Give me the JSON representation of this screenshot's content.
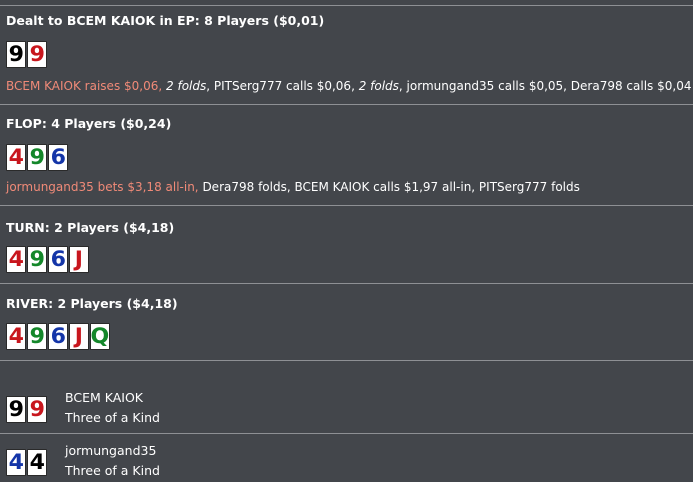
{
  "colors": {
    "background": "#43464b",
    "hero_text": "#f08a78",
    "suit_spades": "#000000",
    "suit_hearts": "#c8161d",
    "suit_diamonds": "#1435a8",
    "suit_clubs": "#14872a"
  },
  "preflop": {
    "title": "Dealt to BCEM KAIOK in EP: 8 Players ($0,01)",
    "cards": [
      {
        "rank": "9",
        "suit": "spades"
      },
      {
        "rank": "9",
        "suit": "hearts"
      }
    ],
    "actions": {
      "hero": "BCEM KAIOK raises $0,06,",
      "folds1": "2 folds",
      "a2": ", PITSerg777 calls $0,06, ",
      "folds2": "2 folds",
      "a3": ", jormungand35 calls $0,05, Dera798 calls $0,04"
    }
  },
  "flop": {
    "title": "FLOP: 4 Players ($0,24)",
    "cards": [
      {
        "rank": "4",
        "suit": "hearts"
      },
      {
        "rank": "9",
        "suit": "clubs"
      },
      {
        "rank": "6",
        "suit": "diamonds"
      }
    ],
    "actions": {
      "hero": "jormungand35 bets $3,18 all-in,",
      "rest": " Dera798 folds, BCEM KAIOK calls $1,97 all-in, PITSerg777 folds"
    }
  },
  "turn": {
    "title": "TURN: 2 Players ($4,18)",
    "cards": [
      {
        "rank": "4",
        "suit": "hearts"
      },
      {
        "rank": "9",
        "suit": "clubs"
      },
      {
        "rank": "6",
        "suit": "diamonds"
      },
      {
        "rank": "J",
        "suit": "hearts"
      }
    ]
  },
  "river": {
    "title": "RIVER: 2 Players ($4,18)",
    "cards": [
      {
        "rank": "4",
        "suit": "hearts"
      },
      {
        "rank": "9",
        "suit": "clubs"
      },
      {
        "rank": "6",
        "suit": "diamonds"
      },
      {
        "rank": "J",
        "suit": "hearts"
      },
      {
        "rank": "Q",
        "suit": "clubs"
      }
    ]
  },
  "showdown": [
    {
      "name": "BCEM KAIOK",
      "hand": "Three of a Kind",
      "cards": [
        {
          "rank": "9",
          "suit": "spades"
        },
        {
          "rank": "9",
          "suit": "hearts"
        }
      ]
    },
    {
      "name": "jormungand35",
      "hand": "Three of a Kind",
      "cards": [
        {
          "rank": "4",
          "suit": "diamonds"
        },
        {
          "rank": "4",
          "suit": "spades"
        }
      ]
    }
  ]
}
